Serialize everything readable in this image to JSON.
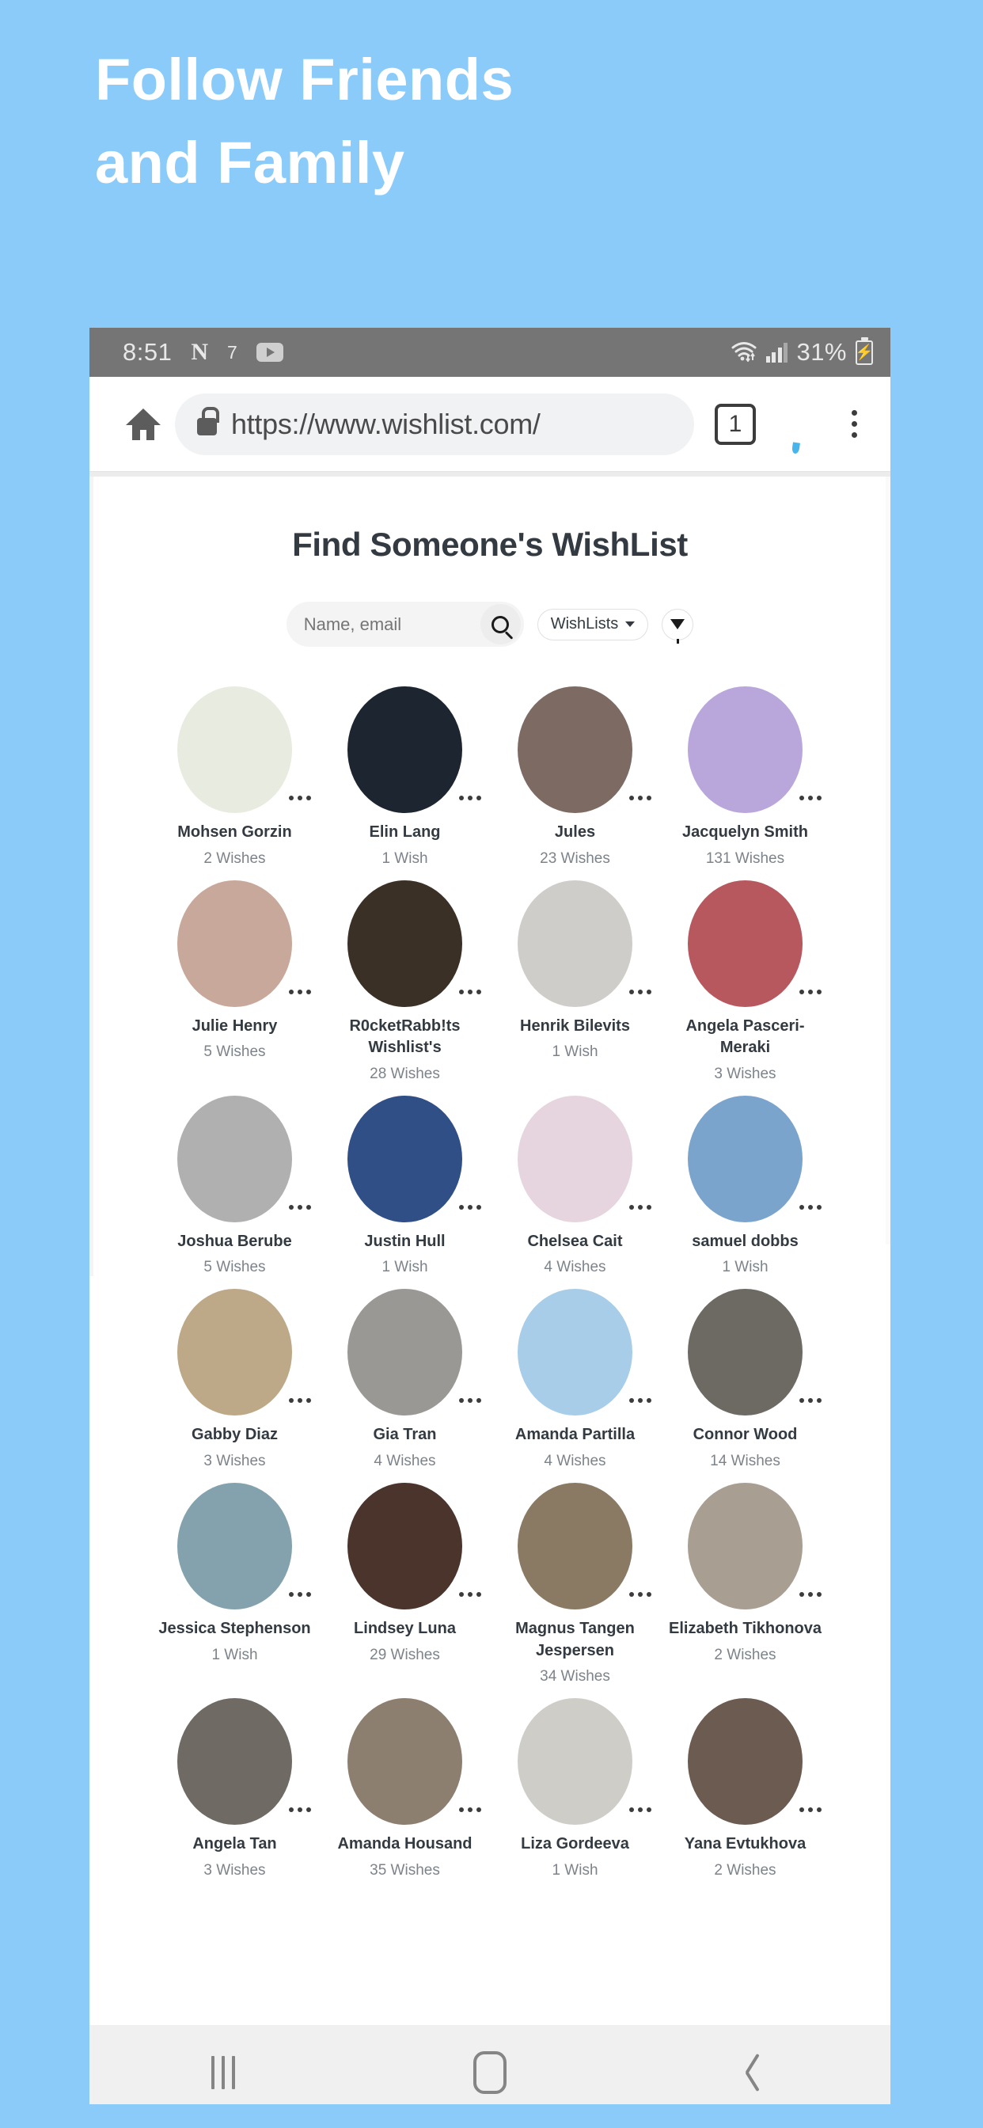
{
  "promo": {
    "line1": "Follow Friends",
    "line2": "and Family",
    "bg_color": "#8BCBF9",
    "text_color": "#FFFFFF"
  },
  "status_bar": {
    "time": "8:51",
    "netflix_icon": "N",
    "notification_count": "7",
    "youtube_icon": "youtube-icon",
    "wifi_icon": "wifi-icon",
    "signal_icon": "signal-bars-icon",
    "battery_percent": "31%",
    "battery_icon": "battery-charging-icon",
    "bg_color": "#757575"
  },
  "browser": {
    "home_icon": "home-icon",
    "lock_icon": "lock-icon",
    "url": "https://www.wishlist.com/",
    "tab_count": "1",
    "balloon_icon": "balloon-icon",
    "menu_icon": "overflow-menu-icon"
  },
  "search": {
    "heading": "Find Someone's WishList",
    "placeholder": "Name, email",
    "value": "",
    "search_icon": "search-icon",
    "scope_label": "WishLists",
    "scope_caret": "chevron-down-icon",
    "filter_icon": "filter-funnel-icon"
  },
  "users": [
    {
      "name": "Mohsen Gorzin",
      "wishes": "2 Wishes",
      "avatar": "#e8ebdf"
    },
    {
      "name": "Elin Lang",
      "wishes": "1 Wish",
      "avatar": "#1d2630"
    },
    {
      "name": "Jules",
      "wishes": "23 Wishes",
      "avatar": "#7d6a63"
    },
    {
      "name": "Jacquelyn Smith",
      "wishes": "131 Wishes",
      "avatar": "#b9a7dc"
    },
    {
      "name": "Julie Henry",
      "wishes": "5 Wishes",
      "avatar": "#c8a89a"
    },
    {
      "name": "R0cketRabb!ts Wishlist's",
      "wishes": "28 Wishes",
      "avatar": "#3a3026"
    },
    {
      "name": "Henrik Bilevits",
      "wishes": "1 Wish",
      "avatar": "#cfcdc9"
    },
    {
      "name": "Angela Pasceri-Meraki",
      "wishes": "3 Wishes",
      "avatar": "#b7575e"
    },
    {
      "name": "Joshua Berube",
      "wishes": "5 Wishes",
      "avatar": "#b0b0b0"
    },
    {
      "name": "Justin Hull",
      "wishes": "1 Wish",
      "avatar": "#2f4f86"
    },
    {
      "name": "Chelsea Cait",
      "wishes": "4 Wishes",
      "avatar": "#e6d5de"
    },
    {
      "name": "samuel dobbs",
      "wishes": "1 Wish",
      "avatar": "#7ba4cc"
    },
    {
      "name": "Gabby Diaz",
      "wishes": "3 Wishes",
      "avatar": "#bda887"
    },
    {
      "name": "Gia Tran",
      "wishes": "4 Wishes",
      "avatar": "#9a9894"
    },
    {
      "name": "Amanda Partilla",
      "wishes": "4 Wishes",
      "avatar": "#a7cde8"
    },
    {
      "name": "Connor Wood",
      "wishes": "14 Wishes",
      "avatar": "#6d6a63"
    },
    {
      "name": "Jessica Stephenson",
      "wishes": "1 Wish",
      "avatar": "#84a2ae"
    },
    {
      "name": "Lindsey Luna",
      "wishes": "29 Wishes",
      "avatar": "#4a342c"
    },
    {
      "name": "Magnus Tangen Jespersen",
      "wishes": "34 Wishes",
      "avatar": "#8a7a64"
    },
    {
      "name": "Elizabeth Tikhonova",
      "wishes": "2 Wishes",
      "avatar": "#a99e92"
    },
    {
      "name": "Angela Tan",
      "wishes": "3 Wishes",
      "avatar": "#6f6a64"
    },
    {
      "name": "Amanda Housand",
      "wishes": "35 Wishes",
      "avatar": "#8d7f70"
    },
    {
      "name": "Liza Gordeeva",
      "wishes": "1 Wish",
      "avatar": "#cfcdc8"
    },
    {
      "name": "Yana Evtukhova",
      "wishes": "2 Wishes",
      "avatar": "#6b5b50"
    }
  ],
  "card_menu_icon": "kebab-menu-icon",
  "nav_bar": {
    "recent_icon": "recent-apps-icon",
    "home_icon": "home-square-icon",
    "back_icon": "back-chevron-icon",
    "bg_color": "#F0F0F0"
  }
}
